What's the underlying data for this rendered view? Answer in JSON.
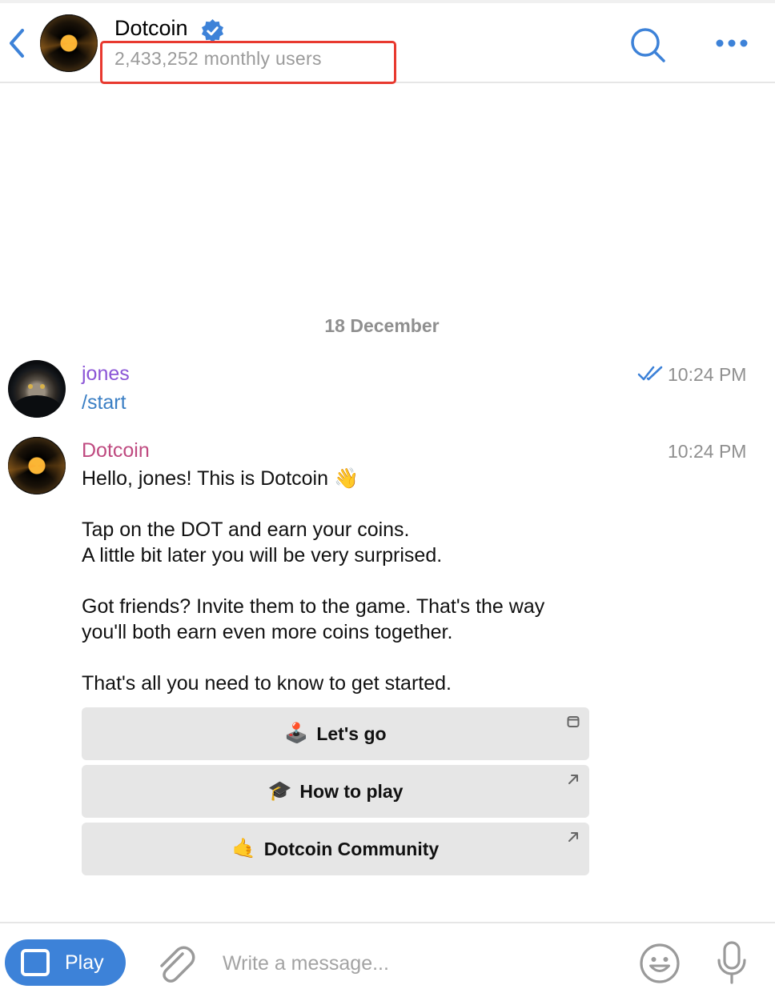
{
  "header": {
    "title": "Dotcoin",
    "subtitle": "2,433,252 monthly users"
  },
  "chat": {
    "date_separator": "18 December",
    "messages": [
      {
        "sender": "jones",
        "text": "/start",
        "time": "10:24 PM",
        "status": "read"
      },
      {
        "sender": "Dotcoin",
        "time": "10:24 PM",
        "lines": [
          "Hello, jones! This is Dotcoin 👋",
          "",
          "Tap on the DOT and earn your coins.",
          "A little bit later you will be very surprised.",
          "",
          "Got friends? Invite them to the game. That's the way",
          "you'll both earn even more coins together.",
          "",
          "That's all you need to know to get started."
        ],
        "buttons": [
          {
            "emoji": "🕹️",
            "label": "Let's go",
            "corner_icon": "web-app-icon"
          },
          {
            "emoji": "🎓",
            "label": "How to play",
            "corner_icon": "external-link-icon"
          },
          {
            "emoji": "🤙",
            "label": "Dotcoin Community",
            "corner_icon": "external-link-icon"
          }
        ]
      }
    ]
  },
  "input_bar": {
    "play_label": "Play",
    "placeholder": "Write a message..."
  },
  "colors": {
    "accent": "#3d82d8",
    "highlight_box": "#e8392f",
    "jones_name": "#8b55d6",
    "dotcoin_name": "#bf4a80"
  }
}
